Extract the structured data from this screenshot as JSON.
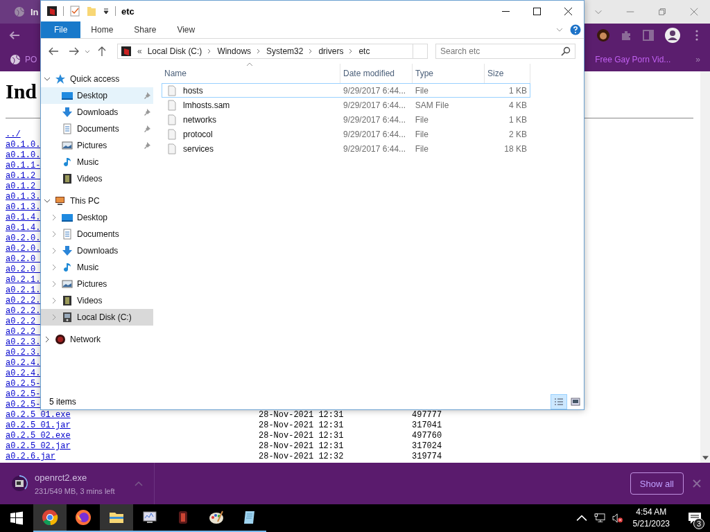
{
  "browser": {
    "tab_title": "In",
    "bookmarks_left": "PO",
    "bookmarks_right": "Free Gay Porn Vid...",
    "bookmarks_more": "»",
    "page": {
      "heading": "Ind",
      "truncated_links": [
        "../",
        "a0.1.0.",
        "a0.1.0.",
        "a0.1.1-",
        "a0.1.2_",
        "a0.1.2_",
        "a0.1.3.",
        "a0.1.3.",
        "a0.1.4.",
        "a0.1.4.",
        "a0.2.0.",
        "a0.2.0.",
        "a0.2.0_",
        "a0.2.0_",
        "a0.2.1.",
        "a0.2.1.",
        "a0.2.2.",
        "a0.2.2.",
        "a0.2.2_",
        "a0.2.2_",
        "a0.2.3.",
        "a0.2.3.",
        "a0.2.4.",
        "a0.2.4.",
        "a0.2.5-",
        "a0.2.5-",
        "a0.2.5-"
      ],
      "rows": [
        {
          "name": "a0.2.5_01.exe",
          "date": "28-Nov-2021 12:31",
          "size": "497777"
        },
        {
          "name": "a0.2.5_01.jar",
          "date": "28-Nov-2021 12:31",
          "size": "317041"
        },
        {
          "name": "a0.2.5_02.exe",
          "date": "28-Nov-2021 12:31",
          "size": "497760"
        },
        {
          "name": "a0.2.5_02.jar",
          "date": "28-Nov-2021 12:31",
          "size": "317024"
        },
        {
          "name": "a0.2.6.jar",
          "date": "28-Nov-2021 12:32",
          "size": "319774"
        }
      ]
    },
    "download": {
      "file": "openrct2.exe",
      "progress_text": "231/549 MB, 3 mins left",
      "show_all": "Show all"
    }
  },
  "explorer": {
    "window_title": "etc",
    "ribbon_tabs": [
      {
        "label": "File",
        "selected": true
      },
      {
        "label": "Home",
        "selected": false
      },
      {
        "label": "Share",
        "selected": false
      },
      {
        "label": "View",
        "selected": false
      }
    ],
    "address": {
      "prefix": "«",
      "crumbs": [
        "Local Disk (C:)",
        "Windows",
        "System32",
        "drivers",
        "etc"
      ]
    },
    "search": {
      "placeholder": "Search etc"
    },
    "nav": [
      {
        "label": "Quick access",
        "kind": "star",
        "expanded": true,
        "selected": false,
        "hovered": false,
        "children": [
          {
            "label": "Desktop",
            "kind": "desktop",
            "pinned": true,
            "selected": false,
            "hovered": true
          },
          {
            "label": "Downloads",
            "kind": "downloads",
            "pinned": true,
            "selected": false,
            "hovered": false
          },
          {
            "label": "Documents",
            "kind": "documents",
            "pinned": true,
            "selected": false,
            "hovered": false
          },
          {
            "label": "Pictures",
            "kind": "pictures",
            "pinned": true,
            "selected": false,
            "hovered": false
          },
          {
            "label": "Music",
            "kind": "music",
            "pinned": false,
            "selected": false,
            "hovered": false
          },
          {
            "label": "Videos",
            "kind": "videos",
            "pinned": false,
            "selected": false,
            "hovered": false
          }
        ]
      },
      {
        "label": "This PC",
        "kind": "pc",
        "expanded": true,
        "selected": false,
        "hovered": false,
        "children": [
          {
            "label": "Desktop",
            "kind": "desktop",
            "expanded": false,
            "selected": false,
            "hovered": false
          },
          {
            "label": "Documents",
            "kind": "documents",
            "expanded": false,
            "selected": false,
            "hovered": false
          },
          {
            "label": "Downloads",
            "kind": "downloads",
            "expanded": false,
            "selected": false,
            "hovered": false
          },
          {
            "label": "Music",
            "kind": "music",
            "expanded": false,
            "selected": false,
            "hovered": false
          },
          {
            "label": "Pictures",
            "kind": "pictures",
            "expanded": false,
            "selected": false,
            "hovered": false
          },
          {
            "label": "Videos",
            "kind": "videos",
            "expanded": false,
            "selected": false,
            "hovered": false
          },
          {
            "label": "Local Disk (C:)",
            "kind": "disk",
            "expanded": false,
            "selected": true,
            "hovered": false
          }
        ]
      },
      {
        "label": "Network",
        "kind": "network",
        "expanded": false,
        "selected": false,
        "hovered": false
      }
    ],
    "columns": [
      "Name",
      "Date modified",
      "Type",
      "Size"
    ],
    "files": [
      {
        "name": "hosts",
        "date": "9/29/2017 6:44...",
        "type": "File",
        "size": "1 KB",
        "focused": true
      },
      {
        "name": "lmhosts.sam",
        "date": "9/29/2017 6:44...",
        "type": "SAM File",
        "size": "4 KB",
        "focused": false
      },
      {
        "name": "networks",
        "date": "9/29/2017 6:44...",
        "type": "File",
        "size": "1 KB",
        "focused": false
      },
      {
        "name": "protocol",
        "date": "9/29/2017 6:44...",
        "type": "File",
        "size": "2 KB",
        "focused": false
      },
      {
        "name": "services",
        "date": "9/29/2017 6:44...",
        "type": "File",
        "size": "18 KB",
        "focused": false
      }
    ],
    "status": "5 items",
    "views": [
      {
        "kind": "details",
        "selected": true
      },
      {
        "kind": "tiles",
        "selected": false
      }
    ]
  },
  "taskbar": {
    "apps": [
      {
        "kind": "chrome",
        "active": true
      },
      {
        "kind": "firefox",
        "active": false
      },
      {
        "kind": "explorer",
        "active": true
      },
      {
        "kind": "monitor",
        "active": false
      },
      {
        "kind": "game",
        "active": false
      },
      {
        "kind": "paint",
        "active": false
      },
      {
        "kind": "notepad",
        "active": false
      }
    ],
    "time": "4:54 AM",
    "date": "5/21/2023",
    "notifications": "3"
  }
}
